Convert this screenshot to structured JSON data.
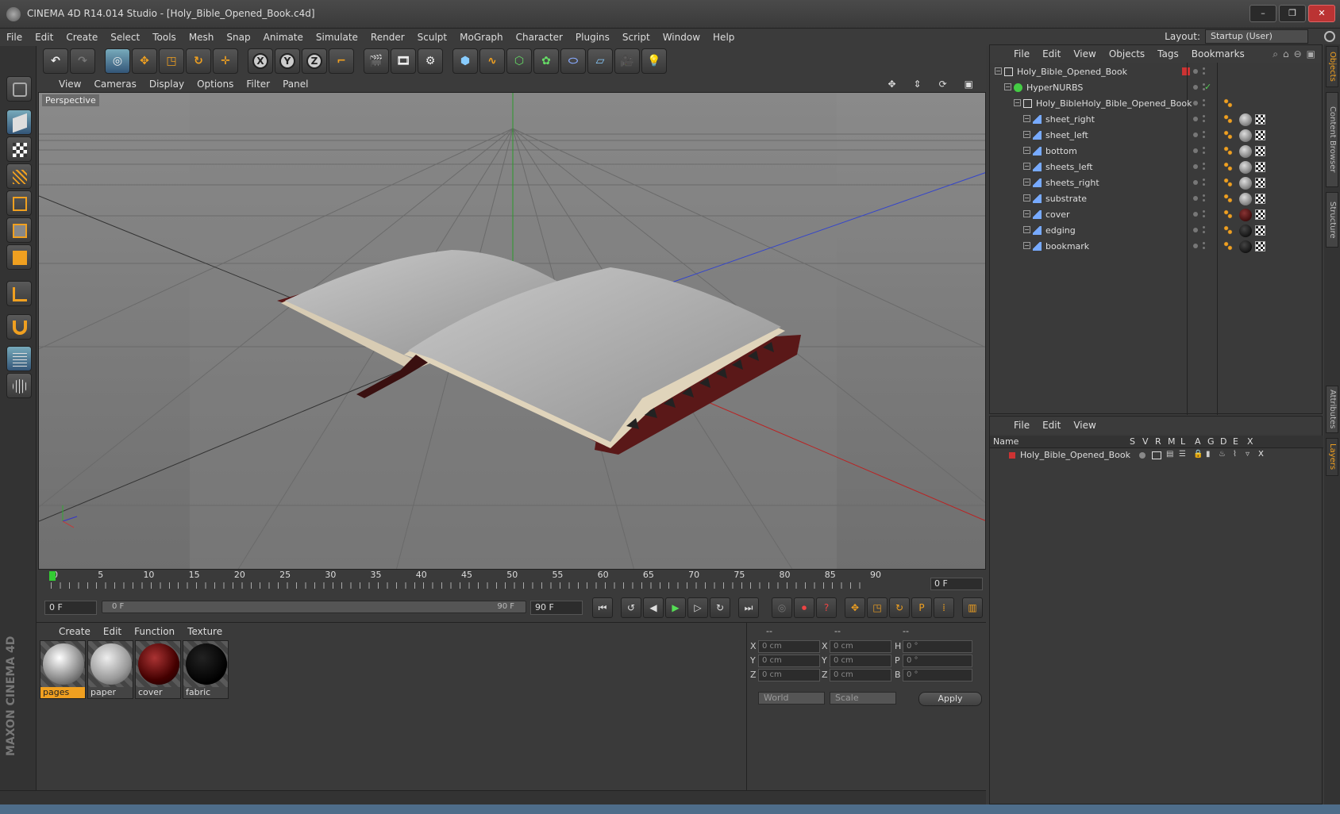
{
  "window": {
    "title": "CINEMA 4D R14.014 Studio - [Holy_Bible_Opened_Book.c4d]",
    "controls": [
      "–",
      "❐",
      "✕"
    ]
  },
  "menubar": {
    "items": [
      "File",
      "Edit",
      "Create",
      "Select",
      "Tools",
      "Mesh",
      "Snap",
      "Animate",
      "Simulate",
      "Render",
      "Sculpt",
      "MoGraph",
      "Character",
      "Plugins",
      "Script",
      "Window",
      "Help"
    ]
  },
  "layout": {
    "label": "Layout:",
    "value": "Startup (User)"
  },
  "viewport": {
    "menu": [
      "View",
      "Cameras",
      "Display",
      "Options",
      "Filter",
      "Panel"
    ],
    "label": "Perspective"
  },
  "timeline": {
    "ticks": [
      "0",
      "5",
      "10",
      "15",
      "20",
      "25",
      "30",
      "35",
      "40",
      "45",
      "50",
      "55",
      "60",
      "65",
      "70",
      "75",
      "80",
      "85",
      "90"
    ],
    "current_frame": "0 F"
  },
  "playback": {
    "start": "0 F",
    "slider_start": "0 F",
    "slider_end": "90 F",
    "end": "90 F"
  },
  "materials": {
    "menu": [
      "Create",
      "Edit",
      "Function",
      "Texture"
    ],
    "items": [
      {
        "name": "pages",
        "selected": true
      },
      {
        "name": "paper",
        "selected": false
      },
      {
        "name": "cover",
        "selected": false
      },
      {
        "name": "fabric",
        "selected": false
      }
    ]
  },
  "coords": {
    "headers": [
      "--",
      "--",
      "--"
    ],
    "rows": [
      {
        "a": "X",
        "va": "0 cm",
        "b": "X",
        "vb": "0 cm",
        "c": "H",
        "vc": "0 °"
      },
      {
        "a": "Y",
        "va": "0 cm",
        "b": "Y",
        "vb": "0 cm",
        "c": "P",
        "vc": "0 °"
      },
      {
        "a": "Z",
        "va": "0 cm",
        "b": "Z",
        "vb": "0 cm",
        "c": "B",
        "vc": "0 °"
      }
    ],
    "world": "World",
    "scale": "Scale",
    "apply": "Apply"
  },
  "objects": {
    "menu": [
      "File",
      "Edit",
      "View",
      "Objects",
      "Tags",
      "Bookmarks"
    ],
    "items": [
      {
        "name": "Holy_Bible_Opened_Book",
        "indent": 0,
        "type": "null"
      },
      {
        "name": "HyperNURBS",
        "indent": 1,
        "type": "nurbs"
      },
      {
        "name": "Holy_BibleHoly_Bible_Opened_Book",
        "indent": 2,
        "type": "null"
      },
      {
        "name": "sheet_right",
        "indent": 3,
        "type": "poly",
        "mat": "light"
      },
      {
        "name": "sheet_left",
        "indent": 3,
        "type": "poly",
        "mat": "light"
      },
      {
        "name": "bottom",
        "indent": 3,
        "type": "poly",
        "mat": "light"
      },
      {
        "name": "sheets_left",
        "indent": 3,
        "type": "poly",
        "mat": "light"
      },
      {
        "name": "sheets_right",
        "indent": 3,
        "type": "poly",
        "mat": "light"
      },
      {
        "name": "substrate",
        "indent": 3,
        "type": "poly",
        "mat": "light"
      },
      {
        "name": "cover",
        "indent": 3,
        "type": "poly",
        "mat": "red"
      },
      {
        "name": "edging",
        "indent": 3,
        "type": "poly",
        "mat": "dark"
      },
      {
        "name": "bookmark",
        "indent": 3,
        "type": "poly",
        "mat": "dark"
      }
    ]
  },
  "layers": {
    "menu": [
      "File",
      "Edit",
      "View"
    ],
    "headers": [
      "Name",
      "S",
      "V",
      "R",
      "M",
      "L",
      "A",
      "G",
      "D",
      "E",
      "X"
    ],
    "row": "Holy_Bible_Opened_Book"
  },
  "sidetabs": [
    "Objects",
    "Content Browser",
    "Structure",
    "Attributes",
    "Layers"
  ],
  "colors": {
    "accent": "#f0a020",
    "background": "#3a3a3a"
  }
}
